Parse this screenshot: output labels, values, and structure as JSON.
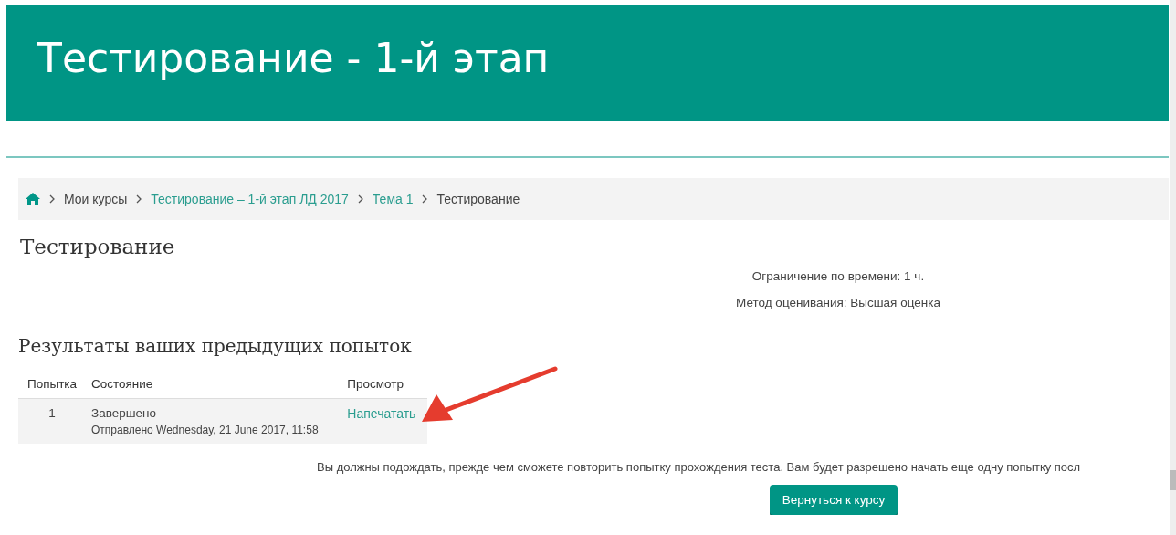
{
  "header": {
    "title": "Тестирование - 1-й этап"
  },
  "breadcrumb": [
    {
      "label": "Мои курсы",
      "link": false
    },
    {
      "label": "Тестирование – 1-й этап ЛД 2017",
      "link": true
    },
    {
      "label": "Тема 1",
      "link": true
    },
    {
      "label": "Тестирование",
      "link": false
    }
  ],
  "page_title": "Тестирование",
  "info": [
    "Ограничение по времени: 1 ч.",
    "Метод оценивания: Высшая оценка"
  ],
  "results": {
    "title": "Результаты ваших предыдущих попыток",
    "columns": [
      "Попытка",
      "Состояние",
      "Просмотр"
    ],
    "rows": [
      {
        "attempt": "1",
        "state": "Завершено",
        "submitted": "Отправлено Wednesday, 21 June 2017, 11:58",
        "review": "Напечатать"
      }
    ]
  },
  "notice": "Вы должны подождать, прежде чем сможете повторить попытку прохождения теста. Вам будет разрешено начать еще одну попытку посл",
  "back_button": "Вернуться к курсу"
}
